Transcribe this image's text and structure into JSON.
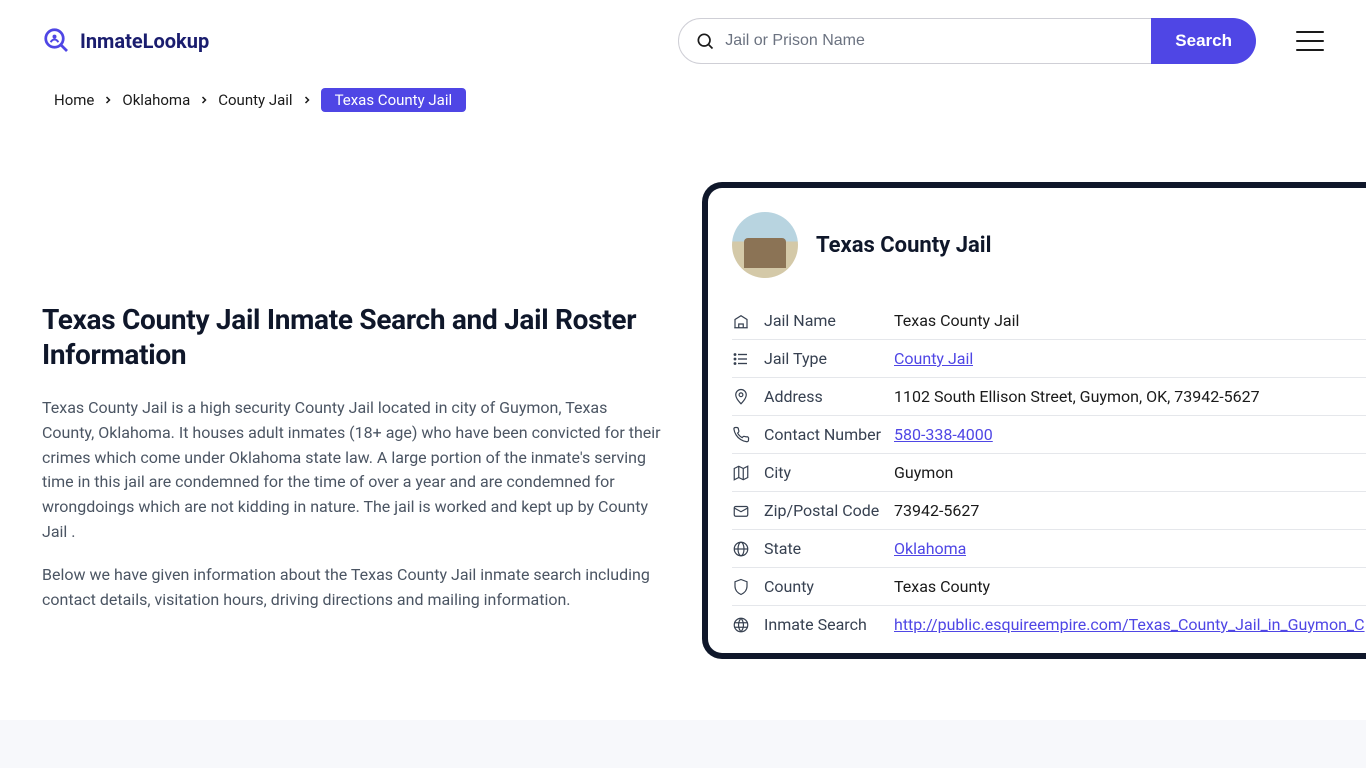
{
  "brand": {
    "name": "InmateLookup"
  },
  "search": {
    "placeholder": "Jail or Prison Name",
    "button": "Search"
  },
  "breadcrumb": {
    "home": "Home",
    "state": "Oklahoma",
    "type": "County Jail",
    "current": "Texas County Jail"
  },
  "article": {
    "heading": "Texas County Jail Inmate Search and Jail Roster Information",
    "p1": "Texas County Jail is a high security County Jail located in city of Guymon, Texas County, Oklahoma. It houses adult inmates (18+ age) who have been convicted for their crimes which come under Oklahoma state law. A large portion of the inmate's serving time in this jail are condemned for the time of over a year and are condemned for wrongdoings which are not kidding in nature. The jail is worked and kept up by County Jail .",
    "p2": "Below we have given information about the Texas County Jail inmate search including contact details, visitation hours, driving directions and mailing information."
  },
  "card": {
    "title": "Texas County Jail",
    "rows": {
      "jail_name": {
        "label": "Jail Name",
        "value": "Texas County Jail"
      },
      "jail_type": {
        "label": "Jail Type",
        "value": "County Jail"
      },
      "address": {
        "label": "Address",
        "value": "1102 South Ellison Street, Guymon, OK, 73942-5627"
      },
      "contact": {
        "label": "Contact Number",
        "value": "580-338-4000"
      },
      "city": {
        "label": "City",
        "value": "Guymon"
      },
      "zip": {
        "label": "Zip/Postal Code",
        "value": "73942-5627"
      },
      "state": {
        "label": "State",
        "value": "Oklahoma"
      },
      "county": {
        "label": "County",
        "value": "Texas County"
      },
      "inmate_search": {
        "label": "Inmate Search",
        "value": "http://public.esquireempire.com/Texas_County_Jail_in_Guymon_C"
      }
    }
  }
}
